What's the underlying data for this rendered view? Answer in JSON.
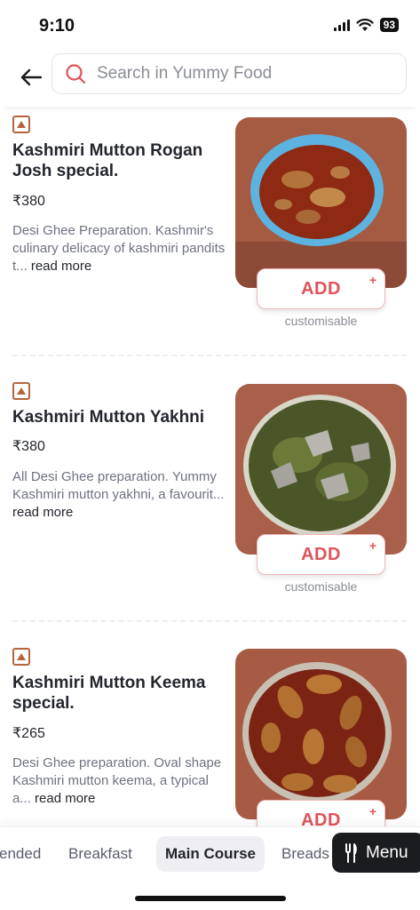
{
  "status": {
    "time": "9:10",
    "battery": "93"
  },
  "search": {
    "placeholder": "Search in Yummy Food"
  },
  "items": [
    {
      "name": "Kashmiri Mutton Rogan Josh special.",
      "price": "₹380",
      "description": "Desi Ghee Preparation. Kashmir's culinary delicacy of kashmiri pandits t...",
      "read_more": "read more",
      "add_label": "ADD",
      "add_plus": "+",
      "custom_label": "customisable"
    },
    {
      "name": "Kashmiri Mutton Yakhni",
      "price": "₹380",
      "description": "All Desi Ghee preparation. Yummy Kashmiri mutton yakhni, a favourit...",
      "read_more": "read more",
      "add_label": "ADD",
      "add_plus": "+",
      "custom_label": "customisable"
    },
    {
      "name": "Kashmiri Mutton Keema special.",
      "price": "₹265",
      "description": "Desi Ghee preparation. Oval shape Kashmiri mutton keema, a typical a...",
      "read_more": "read more",
      "add_label": "ADD",
      "add_plus": "+"
    }
  ],
  "tabs": [
    "ended",
    "Breakfast",
    "Main Course",
    "Breads"
  ],
  "active_tab": "Main Course",
  "menu_button": {
    "label": "Menu"
  },
  "colors": {
    "accent": "#e0535a",
    "nonveg": "#b5643f",
    "menu_bg": "#1b1c1f"
  }
}
